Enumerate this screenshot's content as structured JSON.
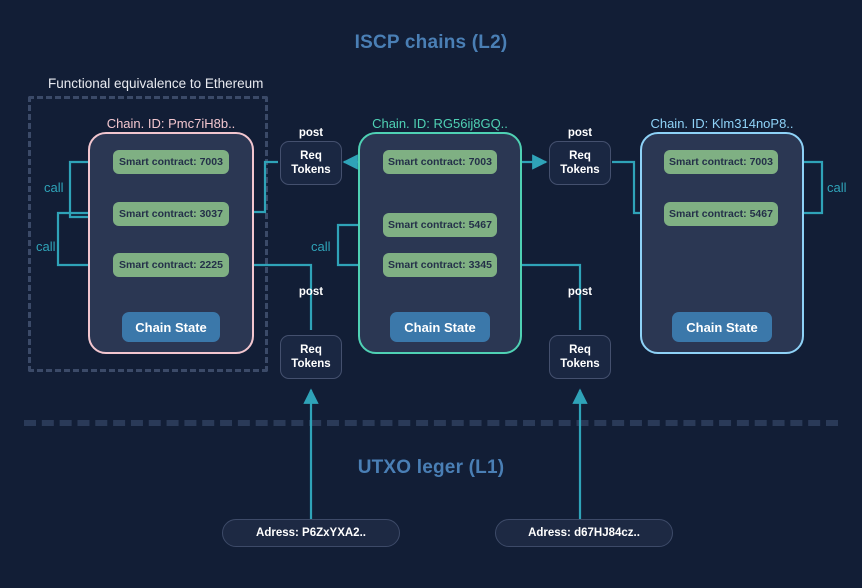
{
  "diagram": {
    "l2_title": "ISCP chains (L2)",
    "l1_title": "UTXO leger (L1)",
    "functional_equivalence_label": "Functional equivalence to Ethereum",
    "colors": {
      "background": "#121e36",
      "title": "#4a7fb5",
      "chain1_border": "#f2c6cf",
      "chain2_border": "#4fd1b4",
      "chain3_border": "#8ed2f7",
      "chain_fill": "#2b3753",
      "smart_contract": "#7fb083",
      "chain_state": "#3b78aa",
      "arrow": "#2fa3b8",
      "dashed_box": "#3b4a68"
    }
  },
  "chains": [
    {
      "label": "Chain. ID: Pmc7iH8b..",
      "contracts": [
        {
          "label": "Smart contract: 7003"
        },
        {
          "label": "Smart contract: 3037"
        },
        {
          "label": "Smart contract: 2225"
        }
      ],
      "chain_state": "Chain State"
    },
    {
      "label": "Chain. ID: RG56ij8GQ..",
      "contracts": [
        {
          "label": "Smart contract: 7003"
        },
        {
          "label": "Smart contract: 5467"
        },
        {
          "label": "Smart contract: 3345"
        }
      ],
      "chain_state": "Chain State"
    },
    {
      "label": "Chain. ID: Klm314noP8..",
      "contracts": [
        {
          "label": "Smart contract: 7003"
        },
        {
          "label": "Smart contract: 5467"
        }
      ],
      "chain_state": "Chain State"
    }
  ],
  "req_tokens": [
    {
      "id": "rt-top-left",
      "post": "post",
      "line1": "Req",
      "line2": "Tokens"
    },
    {
      "id": "rt-bottom-left",
      "post": "post",
      "line1": "Req",
      "line2": "Tokens"
    },
    {
      "id": "rt-top-right",
      "post": "post",
      "line1": "Req",
      "line2": "Tokens"
    },
    {
      "id": "rt-bottom-right",
      "post": "post",
      "line1": "Req",
      "line2": "Tokens"
    }
  ],
  "call_labels": [
    {
      "id": "call-c1-a",
      "text": "call"
    },
    {
      "id": "call-c1-b",
      "text": "call"
    },
    {
      "id": "call-c2",
      "text": "call"
    },
    {
      "id": "call-c3",
      "text": "call"
    }
  ],
  "addresses": [
    {
      "label": "Adress: P6ZxYXA2.."
    },
    {
      "label": "Adress: d67HJ84cz.."
    }
  ]
}
